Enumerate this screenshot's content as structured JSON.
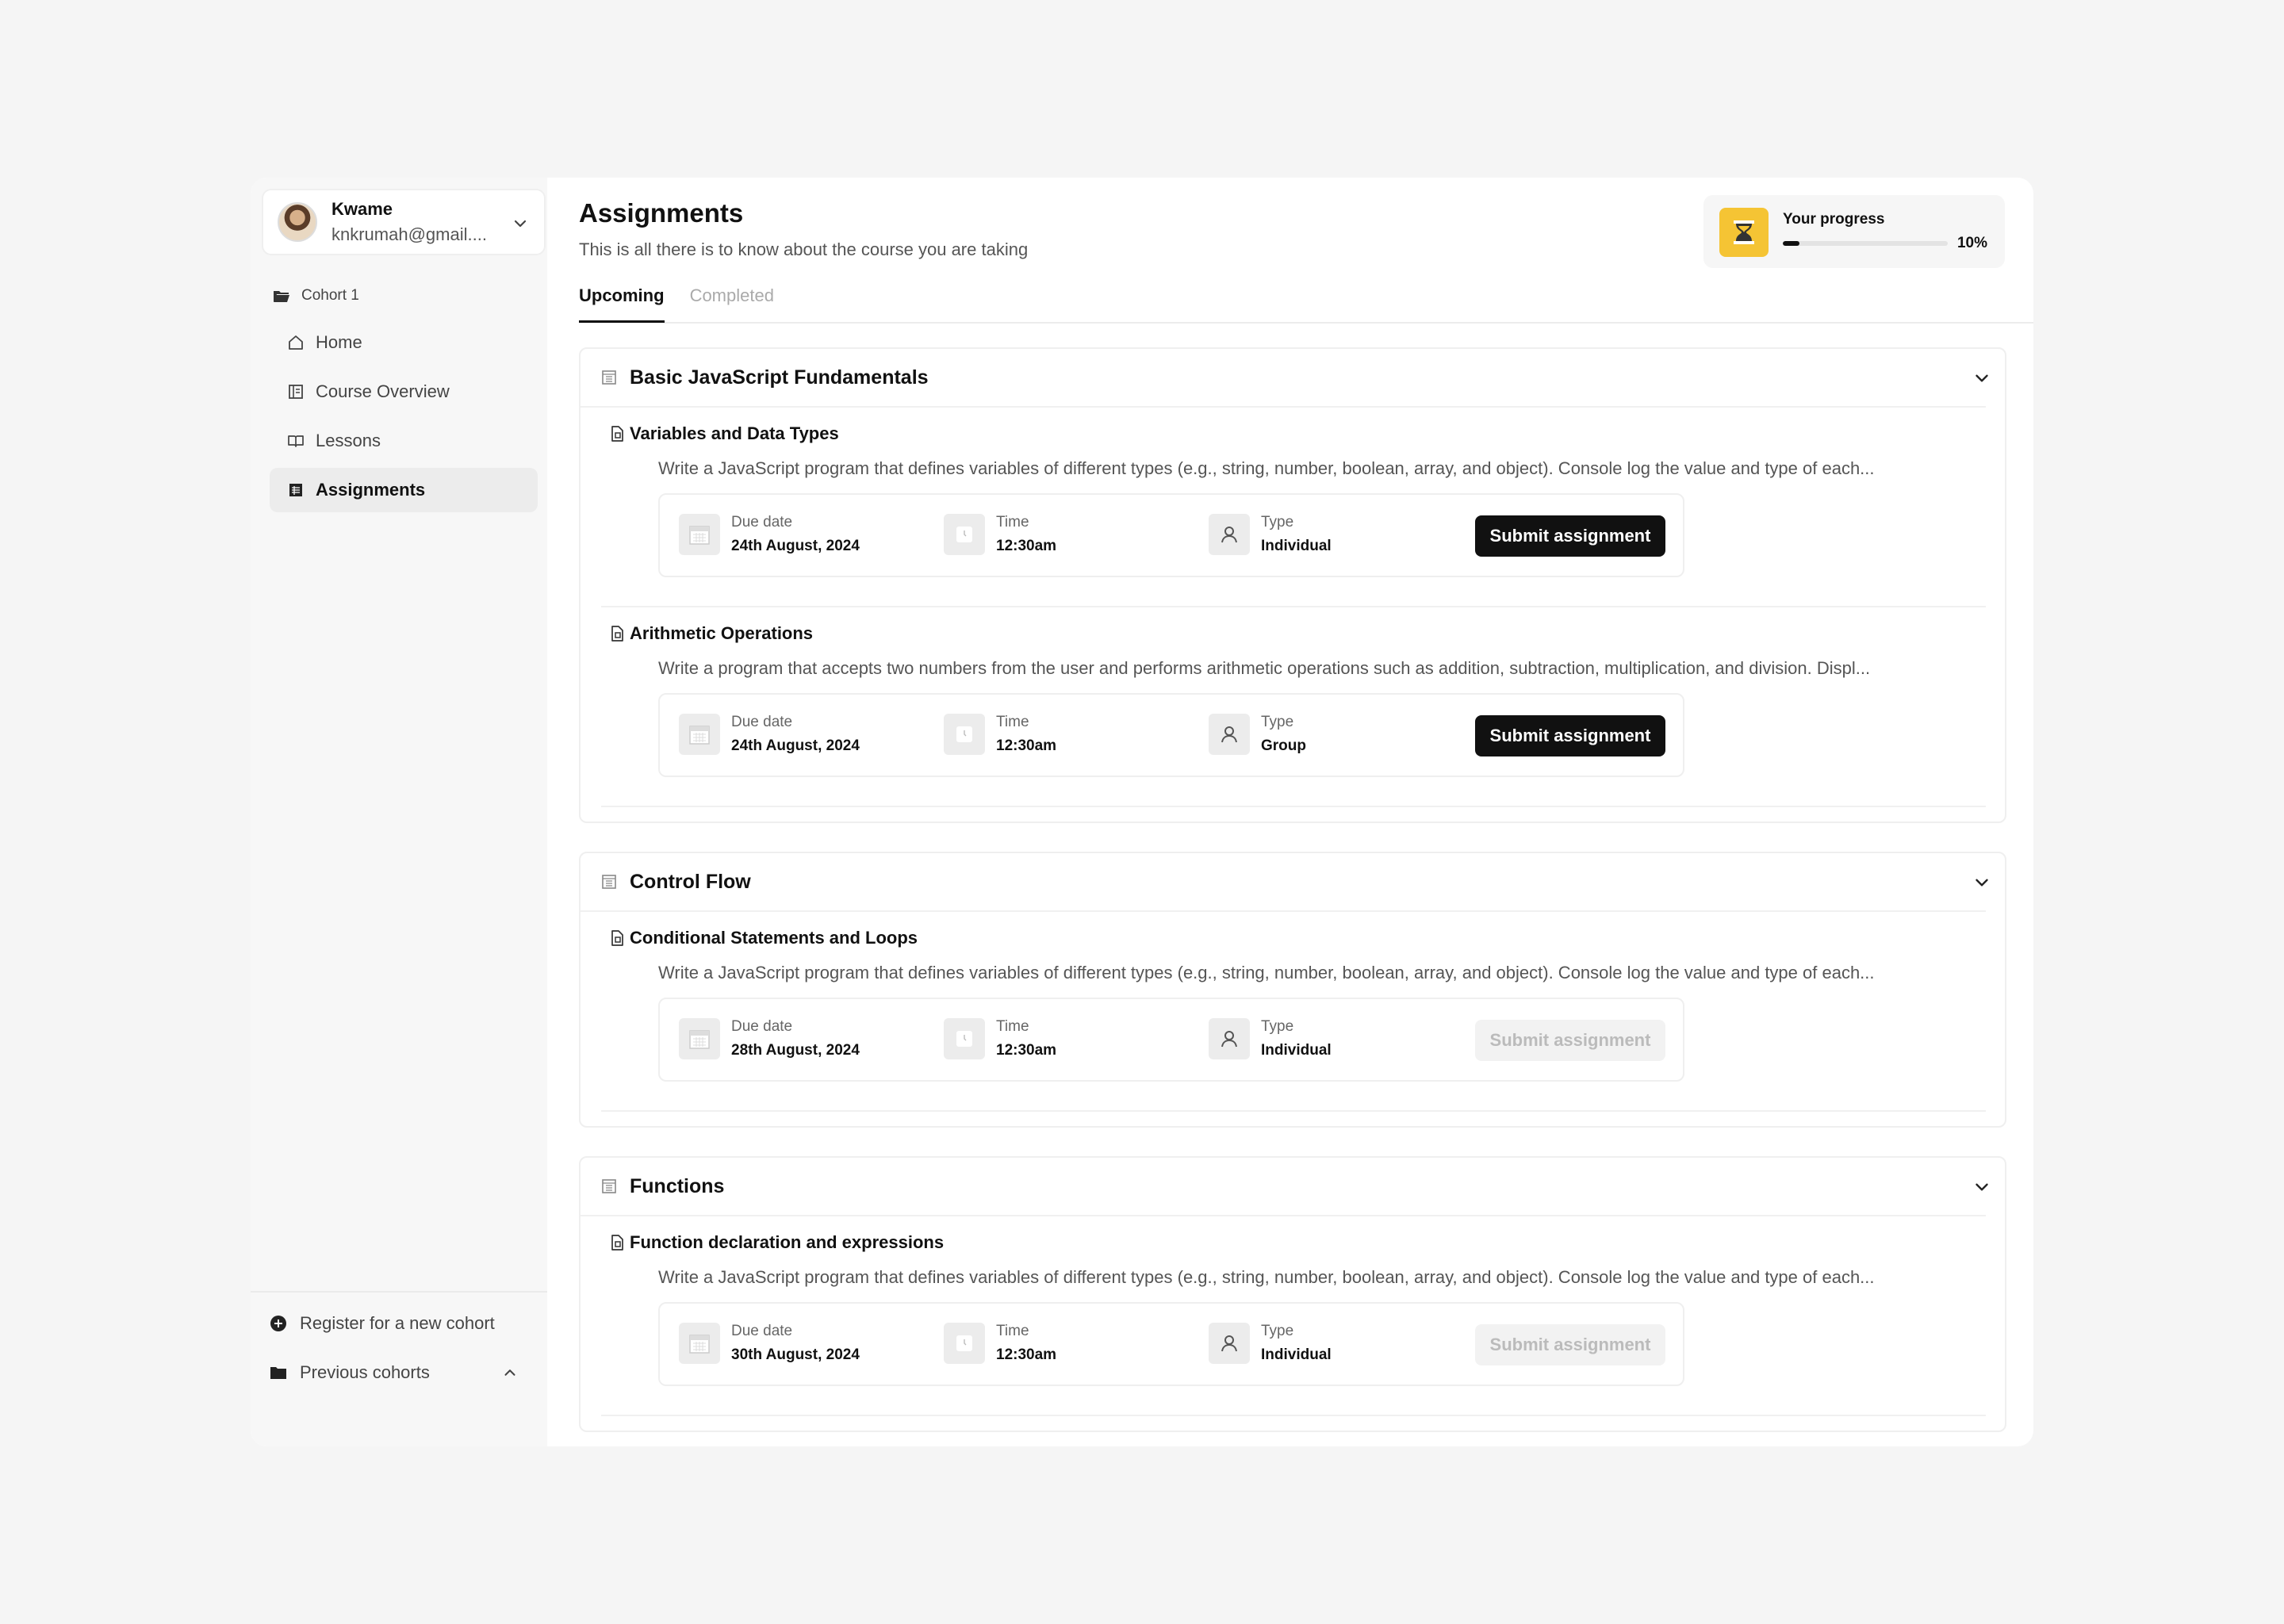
{
  "user": {
    "name": "Kwame",
    "email": "knkrumah@gmail...."
  },
  "sidebar": {
    "cohort": "Cohort 1",
    "items": [
      {
        "label": "Home",
        "icon": "home-icon",
        "active": false
      },
      {
        "label": "Course Overview",
        "icon": "course-overview-icon",
        "active": false
      },
      {
        "label": "Lessons",
        "icon": "book-icon",
        "active": false
      },
      {
        "label": "Assignments",
        "icon": "assignments-icon",
        "active": true
      }
    ],
    "register": "Register for a new cohort",
    "previous": "Previous cohorts"
  },
  "header": {
    "title": "Assignments",
    "subtitle": "This is all there is to know about the course you are taking"
  },
  "progress": {
    "label": "Your progress",
    "value": 10,
    "display": "10%"
  },
  "tabs": [
    {
      "label": "Upcoming",
      "active": true
    },
    {
      "label": "Completed",
      "active": false
    }
  ],
  "labels": {
    "due": "Due date",
    "time": "Time",
    "type": "Type",
    "submit": "Submit assignment"
  },
  "sections": [
    {
      "title": "Basic JavaScript Fundamentals",
      "assignments": [
        {
          "title": "Variables and Data Types",
          "desc": "Write a JavaScript program that defines variables of different types (e.g., string, number, boolean, array, and object). Console log the value and type of each...",
          "due": "24th August, 2024",
          "time": "12:30am",
          "type": "Individual",
          "enabled": true
        },
        {
          "title": "Arithmetic Operations",
          "desc": "Write a program that accepts two numbers from the user and performs arithmetic operations such as addition, subtraction, multiplication, and division. Displ...",
          "due": "24th August, 2024",
          "time": "12:30am",
          "type": "Group",
          "enabled": true
        }
      ]
    },
    {
      "title": "Control Flow",
      "assignments": [
        {
          "title": "Conditional Statements and Loops",
          "desc": "Write a JavaScript program that defines variables of different types (e.g., string, number, boolean, array, and object). Console log the value and type of each...",
          "due": "28th August, 2024",
          "time": "12:30am",
          "type": "Individual",
          "enabled": false
        }
      ]
    },
    {
      "title": "Functions",
      "assignments": [
        {
          "title": "Function declaration and expressions",
          "desc": "Write a JavaScript program that defines variables of different types (e.g., string, number, boolean, array, and object). Console log the value and type of each...",
          "due": "30th August, 2024",
          "time": "12:30am",
          "type": "Individual",
          "enabled": false
        }
      ]
    }
  ]
}
